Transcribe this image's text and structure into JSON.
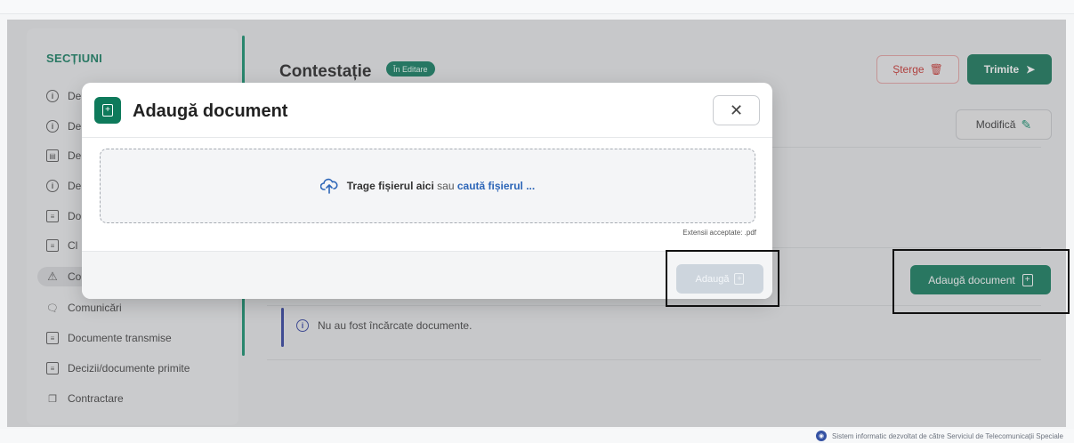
{
  "sidebar": {
    "title": "SECȚIUNI",
    "items": [
      {
        "label": "De",
        "icon": "info-icon"
      },
      {
        "label": "De",
        "icon": "info-icon"
      },
      {
        "label": "De",
        "icon": "id-card-icon"
      },
      {
        "label": "De",
        "icon": "info-icon"
      },
      {
        "label": "Do",
        "icon": "document-icon"
      },
      {
        "label": "Cl",
        "icon": "clipboard-icon"
      },
      {
        "label": "Co",
        "icon": "warning-icon"
      },
      {
        "label": "Comunicări",
        "icon": "chat-icon"
      },
      {
        "label": "Documente transmise",
        "icon": "document-icon"
      },
      {
        "label": "Decizii/documente primite",
        "icon": "document-icon"
      },
      {
        "label": "Contractare",
        "icon": "copy-icon"
      }
    ]
  },
  "page": {
    "title": "Contestație",
    "status_badge": "În Editare",
    "delete_label": "Șterge",
    "send_label": "Trimite",
    "edit_label": "Modifică",
    "add_document_label": "Adaugă document",
    "empty_message": "Nu au fost încărcate documente."
  },
  "modal": {
    "title": "Adaugă document",
    "close_glyph": "✕",
    "drop_text": "Trage fișierul aici",
    "drop_separator": "sau",
    "browse_link": "caută fișierul ...",
    "extensions": "Extensii acceptate: .pdf",
    "submit_label": "Adaugă"
  },
  "footer": {
    "text": "Sistem informatic dezvoltat de către Serviciul de Telecomunicații Speciale"
  },
  "colors": {
    "brand_green": "#0e7a5b",
    "danger_red": "#c9302c",
    "link_blue": "#2d66b8",
    "info_blue": "#2f3fa0"
  }
}
